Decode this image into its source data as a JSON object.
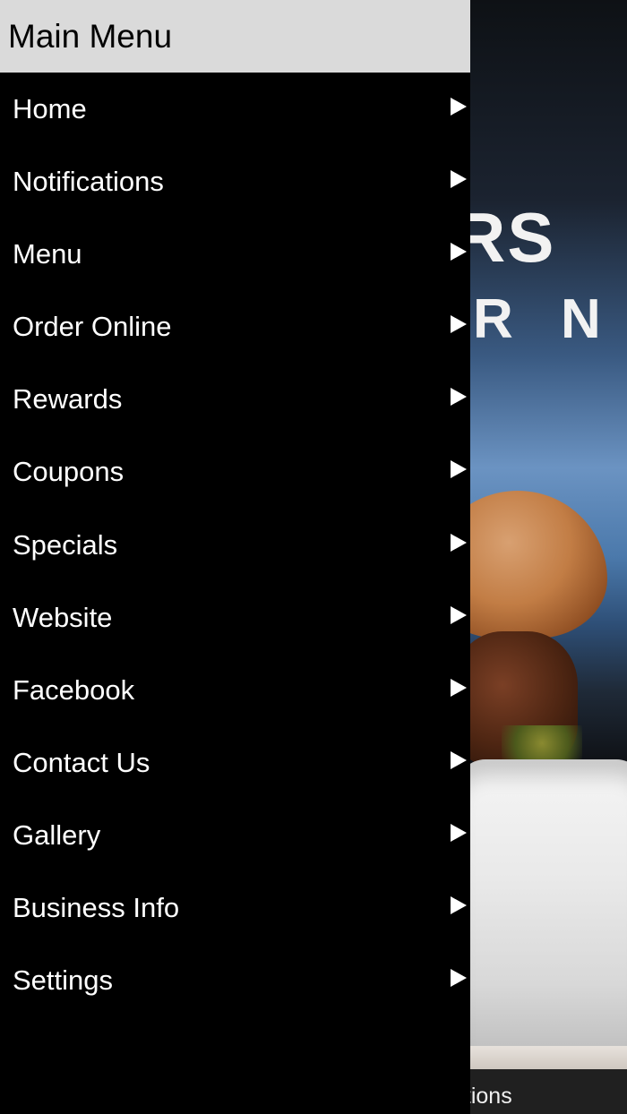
{
  "drawer": {
    "title": "Main Menu",
    "items": [
      {
        "label": "Home"
      },
      {
        "label": "Notifications"
      },
      {
        "label": "Menu"
      },
      {
        "label": "Order Online"
      },
      {
        "label": "Rewards"
      },
      {
        "label": "Coupons"
      },
      {
        "label": "Specials"
      },
      {
        "label": "Website"
      },
      {
        "label": "Facebook"
      },
      {
        "label": "Contact Us"
      },
      {
        "label": "Gallery"
      },
      {
        "label": "Business Info"
      },
      {
        "label": "Settings"
      }
    ],
    "arrow_icon": "play-arrow-icon",
    "header_color": "#dadada",
    "background_color": "#000000"
  },
  "background": {
    "logo_partial": [
      "RS",
      "R N"
    ],
    "tab_label_partial": "fications"
  }
}
